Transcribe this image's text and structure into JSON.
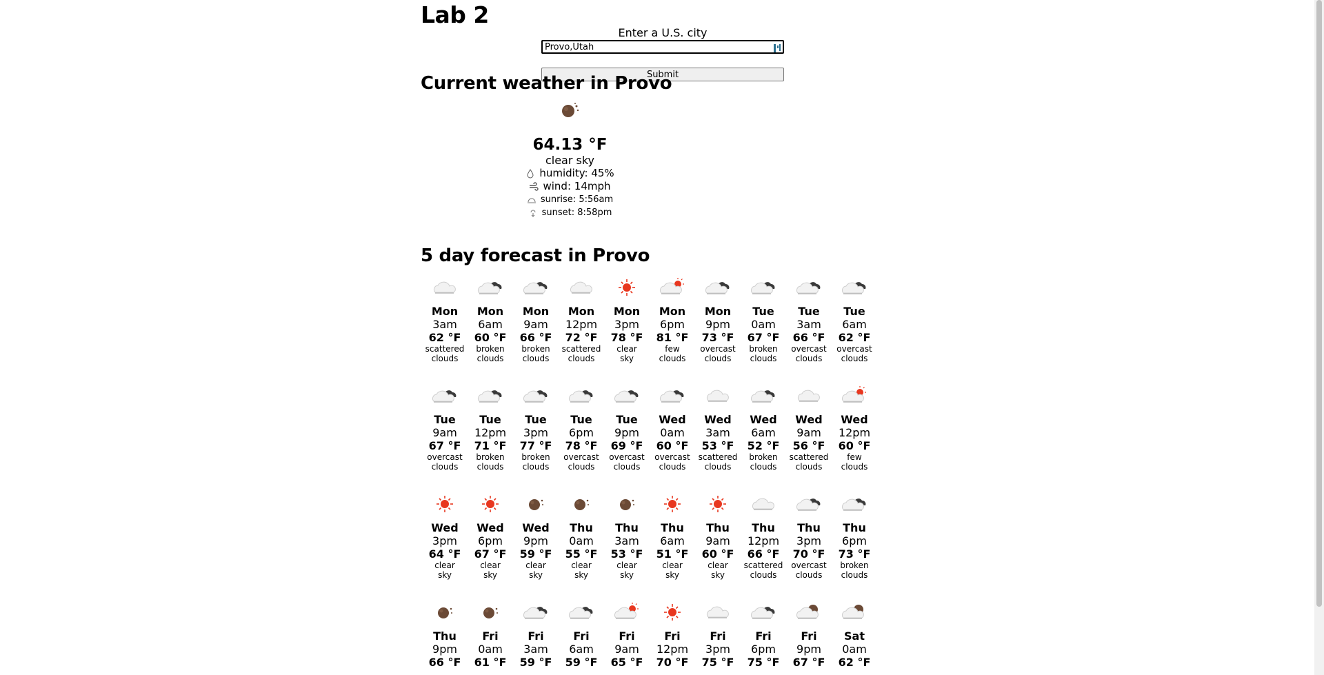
{
  "page": {
    "title": "Lab 2"
  },
  "form": {
    "label": "Enter a U.S. city",
    "city_value": "Provo,Utah",
    "submit_label": "Submit"
  },
  "current": {
    "heading": "Current weather in Provo",
    "temp": "64.13 °F",
    "description": "clear sky",
    "humidity": "humidity: 45%",
    "wind": "wind: 14mph",
    "sunrise": "sunrise: 5:56am",
    "sunset": "sunset: 8:58pm",
    "icon": "moon"
  },
  "forecast": {
    "heading": "5 day forecast in Provo",
    "items": [
      {
        "day": "Mon",
        "time": "3am",
        "temp": "62 °F",
        "desc1": "scattered",
        "desc2": "clouds",
        "icon": "cloud"
      },
      {
        "day": "Mon",
        "time": "6am",
        "temp": "60 °F",
        "desc1": "broken",
        "desc2": "clouds",
        "icon": "cloud-dark"
      },
      {
        "day": "Mon",
        "time": "9am",
        "temp": "66 °F",
        "desc1": "broken",
        "desc2": "clouds",
        "icon": "cloud-dark"
      },
      {
        "day": "Mon",
        "time": "12pm",
        "temp": "72 °F",
        "desc1": "scattered",
        "desc2": "clouds",
        "icon": "cloud"
      },
      {
        "day": "Mon",
        "time": "3pm",
        "temp": "78 °F",
        "desc1": "clear",
        "desc2": "sky",
        "icon": "sun"
      },
      {
        "day": "Mon",
        "time": "6pm",
        "temp": "81 °F",
        "desc1": "few",
        "desc2": "clouds",
        "icon": "cloud-sun"
      },
      {
        "day": "Mon",
        "time": "9pm",
        "temp": "73 °F",
        "desc1": "overcast",
        "desc2": "clouds",
        "icon": "cloud-dark"
      },
      {
        "day": "Tue",
        "time": "0am",
        "temp": "67 °F",
        "desc1": "broken",
        "desc2": "clouds",
        "icon": "cloud-dark"
      },
      {
        "day": "Tue",
        "time": "3am",
        "temp": "66 °F",
        "desc1": "overcast",
        "desc2": "clouds",
        "icon": "cloud-dark"
      },
      {
        "day": "Tue",
        "time": "6am",
        "temp": "62 °F",
        "desc1": "overcast",
        "desc2": "clouds",
        "icon": "cloud-dark"
      },
      {
        "day": "Tue",
        "time": "9am",
        "temp": "67 °F",
        "desc1": "overcast",
        "desc2": "clouds",
        "icon": "cloud-dark"
      },
      {
        "day": "Tue",
        "time": "12pm",
        "temp": "71 °F",
        "desc1": "broken",
        "desc2": "clouds",
        "icon": "cloud-dark"
      },
      {
        "day": "Tue",
        "time": "3pm",
        "temp": "77 °F",
        "desc1": "broken",
        "desc2": "clouds",
        "icon": "cloud-dark"
      },
      {
        "day": "Tue",
        "time": "6pm",
        "temp": "78 °F",
        "desc1": "overcast",
        "desc2": "clouds",
        "icon": "cloud-dark"
      },
      {
        "day": "Tue",
        "time": "9pm",
        "temp": "69 °F",
        "desc1": "overcast",
        "desc2": "clouds",
        "icon": "cloud-dark"
      },
      {
        "day": "Wed",
        "time": "0am",
        "temp": "60 °F",
        "desc1": "overcast",
        "desc2": "clouds",
        "icon": "cloud-dark"
      },
      {
        "day": "Wed",
        "time": "3am",
        "temp": "53 °F",
        "desc1": "scattered",
        "desc2": "clouds",
        "icon": "cloud"
      },
      {
        "day": "Wed",
        "time": "6am",
        "temp": "52 °F",
        "desc1": "broken",
        "desc2": "clouds",
        "icon": "cloud-dark"
      },
      {
        "day": "Wed",
        "time": "9am",
        "temp": "56 °F",
        "desc1": "scattered",
        "desc2": "clouds",
        "icon": "cloud"
      },
      {
        "day": "Wed",
        "time": "12pm",
        "temp": "60 °F",
        "desc1": "few",
        "desc2": "clouds",
        "icon": "cloud-sun"
      },
      {
        "day": "Wed",
        "time": "3pm",
        "temp": "64 °F",
        "desc1": "clear",
        "desc2": "sky",
        "icon": "sun"
      },
      {
        "day": "Wed",
        "time": "6pm",
        "temp": "67 °F",
        "desc1": "clear",
        "desc2": "sky",
        "icon": "sun"
      },
      {
        "day": "Wed",
        "time": "9pm",
        "temp": "59 °F",
        "desc1": "clear",
        "desc2": "sky",
        "icon": "moon"
      },
      {
        "day": "Thu",
        "time": "0am",
        "temp": "55 °F",
        "desc1": "clear",
        "desc2": "sky",
        "icon": "moon"
      },
      {
        "day": "Thu",
        "time": "3am",
        "temp": "53 °F",
        "desc1": "clear",
        "desc2": "sky",
        "icon": "moon"
      },
      {
        "day": "Thu",
        "time": "6am",
        "temp": "51 °F",
        "desc1": "clear",
        "desc2": "sky",
        "icon": "sun"
      },
      {
        "day": "Thu",
        "time": "9am",
        "temp": "60 °F",
        "desc1": "clear",
        "desc2": "sky",
        "icon": "sun"
      },
      {
        "day": "Thu",
        "time": "12pm",
        "temp": "66 °F",
        "desc1": "scattered",
        "desc2": "clouds",
        "icon": "cloud"
      },
      {
        "day": "Thu",
        "time": "3pm",
        "temp": "70 °F",
        "desc1": "overcast",
        "desc2": "clouds",
        "icon": "cloud-dark"
      },
      {
        "day": "Thu",
        "time": "6pm",
        "temp": "73 °F",
        "desc1": "broken",
        "desc2": "clouds",
        "icon": "cloud-dark"
      },
      {
        "day": "Thu",
        "time": "9pm",
        "temp": "66 °F",
        "desc1": "",
        "desc2": "",
        "icon": "moon"
      },
      {
        "day": "Fri",
        "time": "0am",
        "temp": "61 °F",
        "desc1": "",
        "desc2": "",
        "icon": "moon"
      },
      {
        "day": "Fri",
        "time": "3am",
        "temp": "59 °F",
        "desc1": "",
        "desc2": "",
        "icon": "cloud-dark"
      },
      {
        "day": "Fri",
        "time": "6am",
        "temp": "59 °F",
        "desc1": "",
        "desc2": "",
        "icon": "cloud-dark"
      },
      {
        "day": "Fri",
        "time": "9am",
        "temp": "65 °F",
        "desc1": "",
        "desc2": "",
        "icon": "cloud-sun"
      },
      {
        "day": "Fri",
        "time": "12pm",
        "temp": "70 °F",
        "desc1": "",
        "desc2": "",
        "icon": "sun"
      },
      {
        "day": "Fri",
        "time": "3pm",
        "temp": "75 °F",
        "desc1": "",
        "desc2": "",
        "icon": "cloud"
      },
      {
        "day": "Fri",
        "time": "6pm",
        "temp": "75 °F",
        "desc1": "",
        "desc2": "",
        "icon": "cloud-dark"
      },
      {
        "day": "Fri",
        "time": "9pm",
        "temp": "67 °F",
        "desc1": "",
        "desc2": "",
        "icon": "cloud-moon"
      },
      {
        "day": "Sat",
        "time": "0am",
        "temp": "62 °F",
        "desc1": "",
        "desc2": "",
        "icon": "cloud-moon"
      }
    ]
  },
  "colors": {
    "sun": "#e8371f",
    "moon": "#6b4a36",
    "cloud": "#e6e6e6",
    "cloud_dark": "#3a3a3a"
  }
}
